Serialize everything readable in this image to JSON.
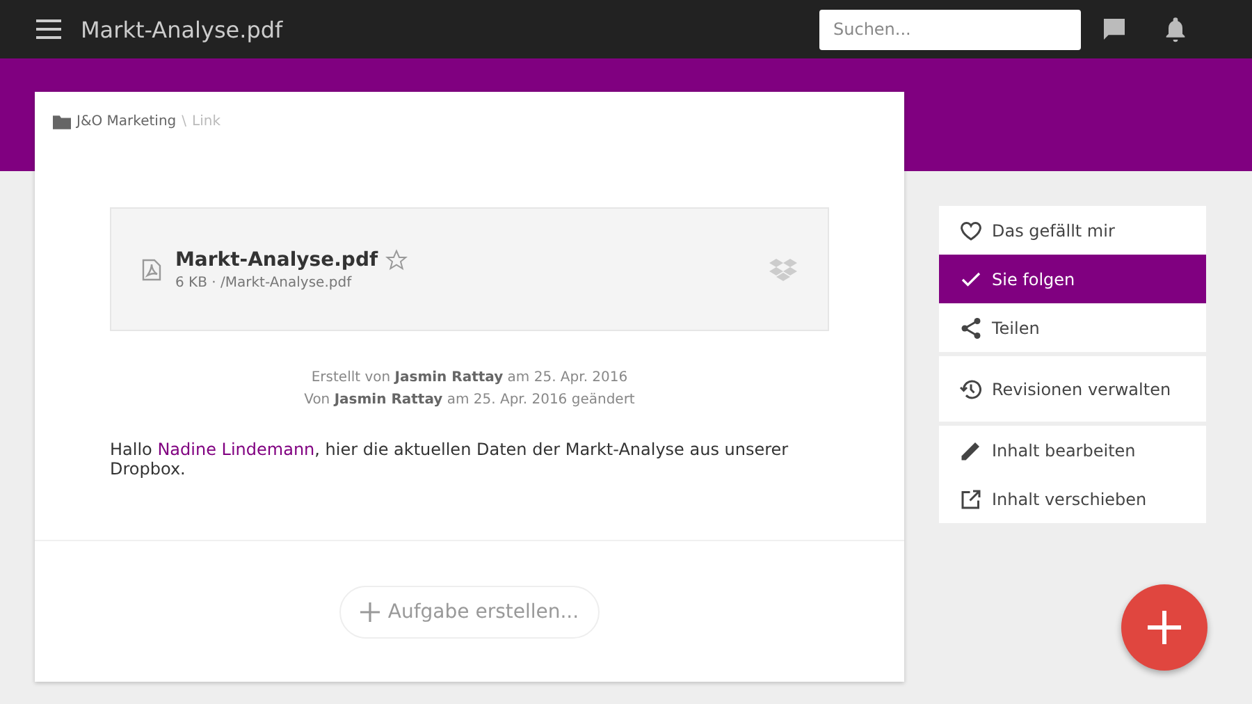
{
  "header": {
    "title": "Markt-Analyse.pdf",
    "search": {
      "placeholder": "Suchen..."
    }
  },
  "breadcrumb": {
    "space": "J&O Marketing",
    "separator": "\\",
    "current": "Link"
  },
  "file": {
    "name": "Markt-Analyse.pdf",
    "starred": false,
    "meta": "6 KB · /Markt-Analyse.pdf"
  },
  "history": [
    "Erstellt von **Jasmin Rattay** am 25. Apr. 2016",
    "Von **Jasmin Rattay** am 25. Apr. 2016 geändert"
  ],
  "message": {
    "before": "Hallo ",
    "mention": "Nadine Lindemann",
    "after": ", hier die aktuellen Daten der Markt-Analyse aus unserer Dropbox."
  },
  "task_button": {
    "label": "Aufgabe erstellen..."
  },
  "actions": [
    [
      {
        "label": "Das gefällt mir",
        "selected": false
      },
      {
        "label": "Sie folgen",
        "selected": true
      },
      {
        "label": "Teilen",
        "selected": false
      }
    ],
    [
      {
        "label": "Revisionen verwalten",
        "selected": false
      }
    ],
    [
      {
        "label": "Inhalt bearbeiten",
        "selected": false
      },
      {
        "label": "Inhalt verschieben",
        "selected": false
      }
    ]
  ]
}
